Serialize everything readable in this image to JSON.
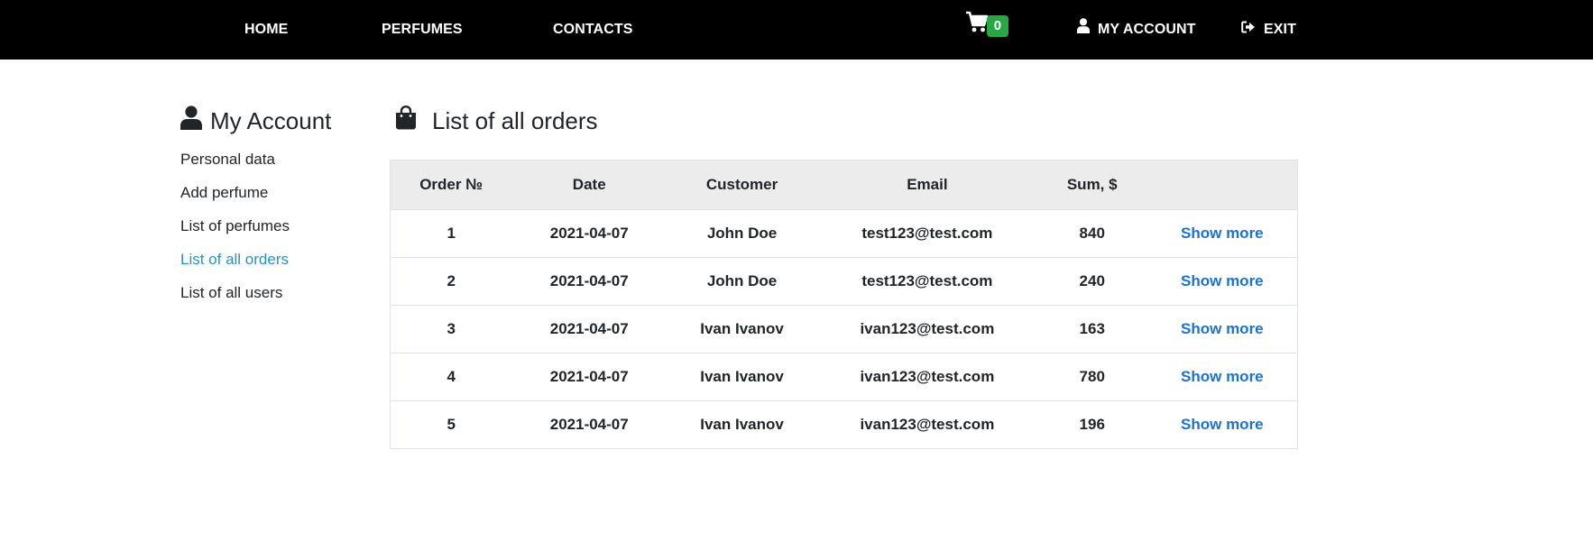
{
  "navbar": {
    "home": "HOME",
    "perfumes": "PERFUMES",
    "contacts": "CONTACTS",
    "cart_count": "0",
    "account": "MY ACCOUNT",
    "exit": "EXIT"
  },
  "sidebar": {
    "title": "My Account",
    "items": [
      {
        "label": "Personal data"
      },
      {
        "label": "Add perfume"
      },
      {
        "label": "List of perfumes"
      },
      {
        "label": "List of all orders"
      },
      {
        "label": "List of all users"
      }
    ],
    "active_index": 3
  },
  "main": {
    "title": "List of all orders",
    "columns": [
      "Order №",
      "Date",
      "Customer",
      "Email",
      "Sum, $",
      ""
    ],
    "rows": [
      {
        "id": "1",
        "date": "2021-04-07",
        "customer": "John Doe",
        "email": "test123@test.com",
        "sum": "840",
        "action": "Show more"
      },
      {
        "id": "2",
        "date": "2021-04-07",
        "customer": "John Doe",
        "email": "test123@test.com",
        "sum": "240",
        "action": "Show more"
      },
      {
        "id": "3",
        "date": "2021-04-07",
        "customer": "Ivan Ivanov",
        "email": "ivan123@test.com",
        "sum": "163",
        "action": "Show more"
      },
      {
        "id": "4",
        "date": "2021-04-07",
        "customer": "Ivan Ivanov",
        "email": "ivan123@test.com",
        "sum": "780",
        "action": "Show more"
      },
      {
        "id": "5",
        "date": "2021-04-07",
        "customer": "Ivan Ivanov",
        "email": "ivan123@test.com",
        "sum": "196",
        "action": "Show more"
      }
    ]
  },
  "colors": {
    "navbar_bg": "#000000",
    "badge": "#28a745",
    "active_link": "#2a91c4",
    "action_link": "#1a73d1",
    "table_header_bg": "#ececec"
  },
  "icons": {
    "cart": "shopping-cart-icon",
    "account": "user-icon",
    "exit": "sign-out-icon",
    "sidebar": "user-icon",
    "orders": "shopping-bag-icon"
  }
}
